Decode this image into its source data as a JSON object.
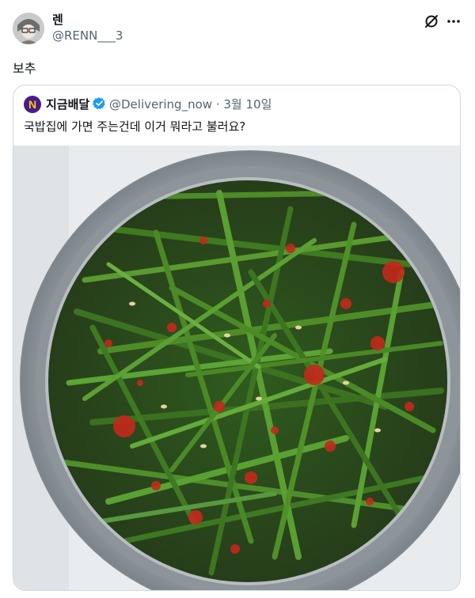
{
  "post": {
    "author_name": "렌",
    "author_handle": "@RENN___3",
    "text": "보추"
  },
  "header_icons": [
    "grok-icon",
    "more-icon"
  ],
  "quote": {
    "author_name": "지금배달",
    "author_handle": "@Delivering_now",
    "date_separator": "·",
    "date": "3월 10일",
    "text": "국밥집에 가면 주는건데 이거 뭐라고 불러요?",
    "verified_color": "#1d9bf0",
    "image_alt": "스테인리스 그릇에 담긴 부추무침"
  },
  "colors": {
    "text": "#0f1419",
    "secondary": "#536471",
    "border": "#cfd9de",
    "brand_avatar": "#4b1a8c",
    "brand_letter": "#ffcc00"
  }
}
